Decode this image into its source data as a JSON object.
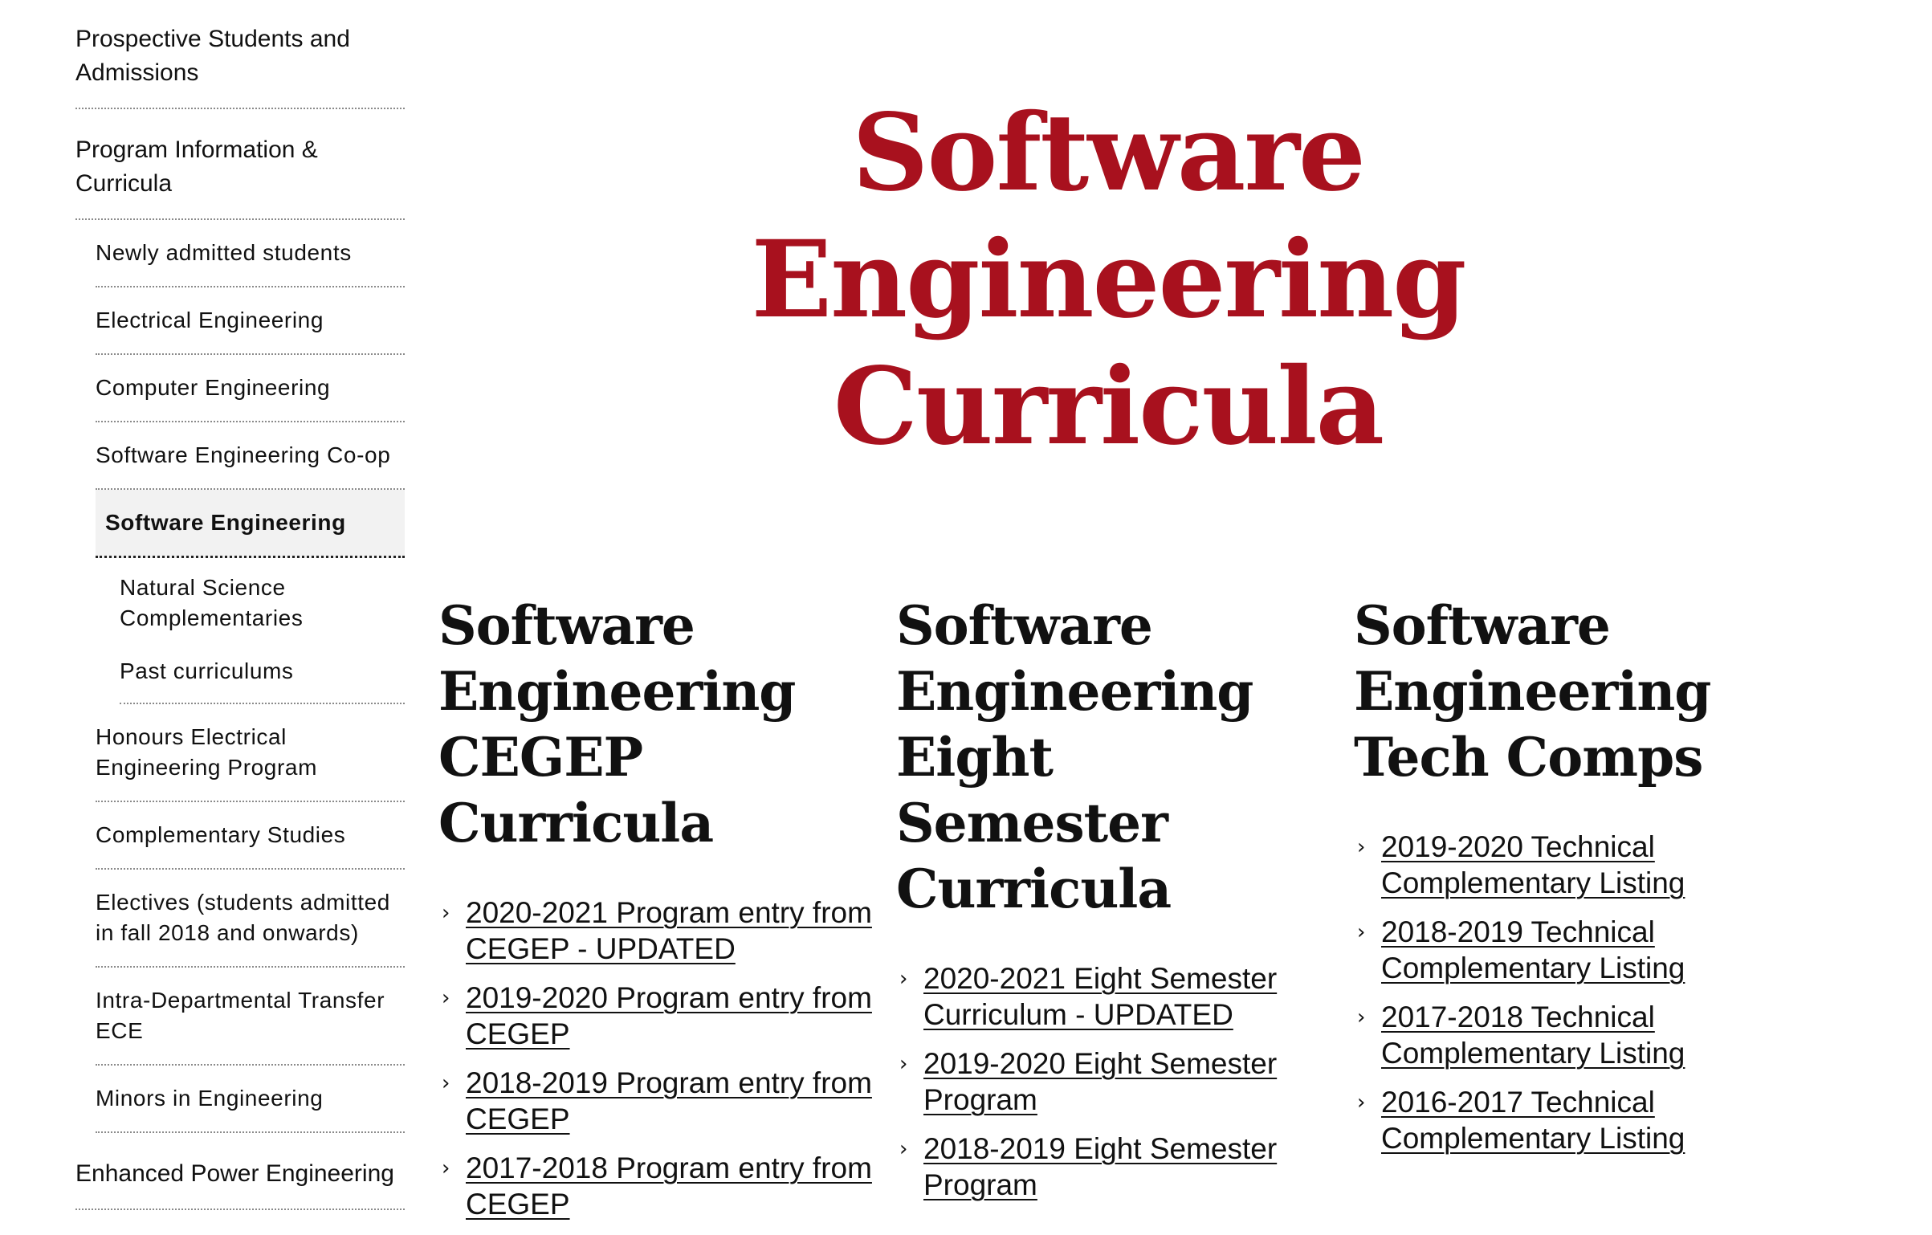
{
  "sidebar": {
    "top_items": [
      {
        "label": "Prospective Students and Admissions"
      },
      {
        "label": "Program Information & Curricula"
      }
    ],
    "sub_items": [
      {
        "label": "Newly admitted students"
      },
      {
        "label": "Electrical Engineering"
      },
      {
        "label": "Computer Engineering"
      },
      {
        "label": "Software Engineering Co-op"
      },
      {
        "label": "Software Engineering"
      }
    ],
    "subsub_items": [
      {
        "label": "Natural Science Complementaries"
      },
      {
        "label": "Past curriculums"
      }
    ],
    "sub_items_after": [
      {
        "label": "Honours Electrical Engineering Program"
      },
      {
        "label": "Complementary Studies"
      },
      {
        "label": "Electives (students admitted in fall 2018 and onwards)"
      },
      {
        "label": "Intra-Departmental Transfer ECE"
      },
      {
        "label": "Minors in Engineering"
      }
    ],
    "bottom_item": {
      "label": "Enhanced Power Engineering"
    }
  },
  "main": {
    "title": "Software Engineering Curricula",
    "columns": [
      {
        "heading": "Software Engineering CEGEP Curricula",
        "links": [
          "2020-2021 Program entry from CEGEP - UPDATED",
          "2019-2020 Program entry from CEGEP",
          "2018-2019 Program entry from CEGEP",
          "2017-2018 Program entry from CEGEP"
        ]
      },
      {
        "heading": "Software Engineering Eight Semester Curricula",
        "links": [
          "2020-2021 Eight Semester Curriculum - UPDATED",
          "2019-2020 Eight Semester Program",
          "2018-2019 Eight Semester Program"
        ]
      },
      {
        "heading": "Software Engineering Tech Comps",
        "links": [
          "2019-2020 Technical Complementary Listing",
          "2018-2019 Technical Complementary Listing",
          "2017-2018 Technical Complementary Listing",
          "2016-2017 Technical Complementary Listing"
        ]
      }
    ]
  },
  "colors": {
    "title": "#a8111e",
    "active_bg": "#f2f2f2"
  },
  "icons": {
    "list_bullet": "chevron-right-icon"
  }
}
